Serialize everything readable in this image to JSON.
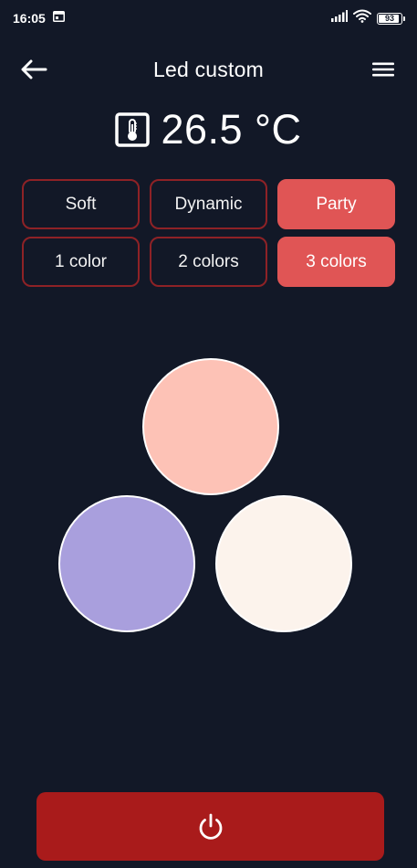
{
  "status_bar": {
    "time": "16:05",
    "battery": "93",
    "battery_level": 0.93
  },
  "header": {
    "title": "Led custom",
    "back_icon": "arrow-left-icon",
    "menu_icon": "hamburger-menu-icon"
  },
  "temperature": {
    "value": "26.5 °C",
    "icon": "thermometer-icon"
  },
  "modes": {
    "effects": [
      {
        "label": "Soft",
        "active": false
      },
      {
        "label": "Dynamic",
        "active": false
      },
      {
        "label": "Party",
        "active": true
      }
    ],
    "color_counts": [
      {
        "label": "1 color",
        "active": false
      },
      {
        "label": "2 colors",
        "active": false
      },
      {
        "label": "3 colors",
        "active": true
      }
    ]
  },
  "colors": {
    "color_1": "#fdc2b6",
    "color_2": "#a99fdd",
    "color_3": "#fcf3ec",
    "accent": "#e05555",
    "power": "#a91b1b",
    "background": "#121827"
  },
  "power": {
    "icon": "power-icon"
  }
}
